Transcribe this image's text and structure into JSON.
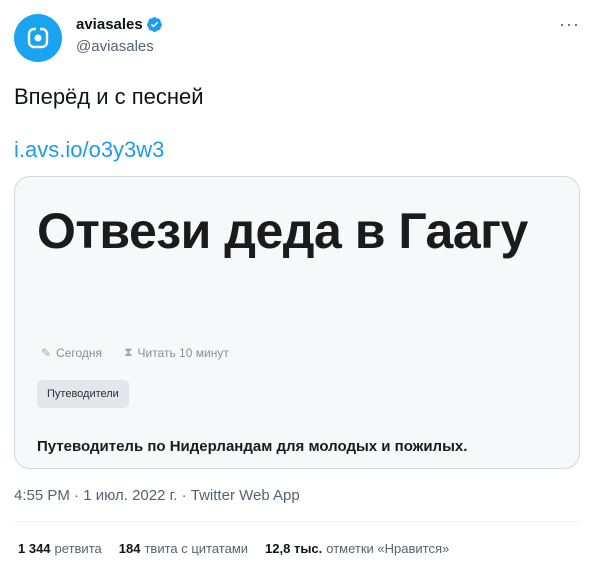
{
  "author": {
    "display_name": "aviasales",
    "handle": "@aviasales",
    "avatar_icon": "plane-logo-icon",
    "verified_icon": "verified-badge-icon"
  },
  "more_label": "···",
  "tweet": {
    "text": "Вперёд и с песней",
    "link": "i.avs.io/o3y3w3"
  },
  "card": {
    "title": "Отвези деда в Гаагу",
    "meta_date": "Сегодня",
    "meta_read": "Читать 10 минут",
    "tag": "Путеводители",
    "description": "Путеводитель по Нидерландам для молодых и пожилых."
  },
  "timestamp": "4:55 PM · 1 июл. 2022 г. · Twitter Web App",
  "stats": {
    "retweets_count": "1 344",
    "retweets_label": "ретвита",
    "quotes_count": "184",
    "quotes_label": "твита с цитатами",
    "likes_count": "12,8 тыс.",
    "likes_label": "отметки «Нравится»"
  },
  "colors": {
    "accent": "#1d9bf0",
    "avatar_bg": "#1aa3ee",
    "card_bg": "#f7f8f9"
  }
}
